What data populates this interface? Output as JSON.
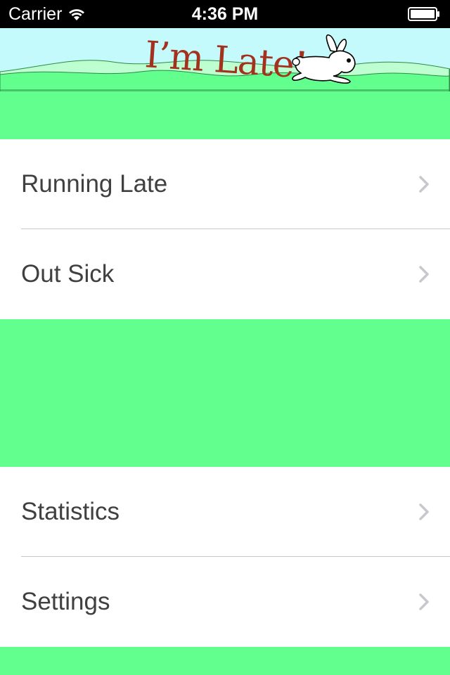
{
  "status_bar": {
    "carrier": "Carrier",
    "time": "4:36 PM",
    "icons": [
      "wifi-icon",
      "battery-icon"
    ]
  },
  "banner": {
    "title": "I’m Late!",
    "icons": [
      "rabbit-icon",
      "hills-illustration"
    ]
  },
  "menu": {
    "section_1": [
      {
        "label": "Running Late"
      },
      {
        "label": "Out Sick"
      }
    ],
    "section_2": [
      {
        "label": "Statistics"
      },
      {
        "label": "Settings"
      }
    ],
    "chevron_icon": "chevron-right-icon"
  },
  "colors": {
    "background_green": "#62ff8e",
    "banner_sky": "#c5fafd",
    "hill_light": "#bdffd0",
    "title_red": "#a2321d",
    "text": "#404040",
    "chevron": "#c7c7cc",
    "separator": "#c8c7cc"
  }
}
